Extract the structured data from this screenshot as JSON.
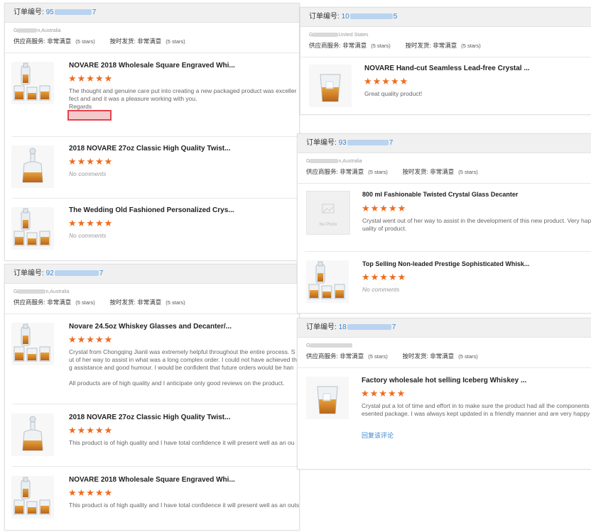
{
  "labels": {
    "order_prefix": "订单编号:",
    "supplier_service": "供应商服务:",
    "on_time_shipping": "按时发货:",
    "very_satisfied": "非常满意",
    "five_stars": "(5 stars)",
    "stars": "★★★★★",
    "no_comments": "No comments",
    "no_photo": "No Photo",
    "reply_link": "回复该评论"
  },
  "orders": [
    {
      "order_start": "95",
      "order_end": "7",
      "loc_start": "G",
      "loc_end": "n,Australia",
      "items": [
        {
          "title": "NOVARE 2018 Wholesale Square Engraved Whi...",
          "comment_lines": [
            "The thought and genuine care put into creating a new packaged product was exceller",
            "fect and and it was a pleasure working with you.",
            "Regards"
          ]
        },
        {
          "title": "2018 NOVARE 27oz Classic High Quality Twist...",
          "no_comments": true
        },
        {
          "title": "The Wedding Old Fashioned Personalized Crys...",
          "no_comments": true
        }
      ]
    },
    {
      "order_start": "10",
      "order_end": "5",
      "loc_start": "G",
      "loc_end": "United States",
      "items": [
        {
          "title": "NOVARE Hand-cut Seamless Lead-free Crystal ...",
          "comment_lines": [
            "Great quality product!"
          ]
        }
      ]
    },
    {
      "order_start": "93",
      "order_end": "7",
      "loc_start": "G",
      "loc_end": "n,Australia",
      "items": [
        {
          "title": "800 ml Fashionable Twisted Crystal Glass Decanter",
          "comment_lines": [
            "Crystal went out of her way to assist in the development of this new product. Very hap",
            "uality of product."
          ]
        },
        {
          "title": "Top Selling Non-leaded Prestige Sophisticated Whisk...",
          "no_comments": true
        }
      ]
    },
    {
      "order_start": "92",
      "order_end": "7",
      "loc_start": "G",
      "loc_end": "n,Australia",
      "items": [
        {
          "title": "Novare 24.5oz Whiskey Glasses and Decanter/...",
          "comment_lines": [
            "Crystal from Chongqing Jianli was extremely helpful throughout the entire process. S",
            "ut of her way to assist in what was a long complex order. I could not have achieved th",
            "g assistance and good humour. I would be confident that future orders would be han",
            "",
            "All products are of high quality and I anticipate only good reviews on the product."
          ]
        },
        {
          "title": "2018 NOVARE 27oz Classic High Quality Twist...",
          "comment_lines": [
            "This product is of high quality and I have total confidence it will present well as an ou"
          ]
        },
        {
          "title": "NOVARE 2018 Wholesale Square Engraved Whi...",
          "comment_lines": [
            "This product is of high quality and I have total confidence it will present well as an outstanding item"
          ]
        }
      ]
    },
    {
      "order_start": "18",
      "order_end": "7",
      "loc_start": "G",
      "loc_end": "",
      "items": [
        {
          "title": "Factory wholesale hot selling Iceberg Whiskey ...",
          "comment_lines": [
            "Crystal put a lot of time and effort in to make sure the product had all the components",
            "esented package. I was always kept updated in a friendly manner and are very happy"
          ]
        }
      ]
    }
  ],
  "colors": {
    "star": "#ee6b1e",
    "link": "#3b86d0",
    "redact": "#e3424b"
  }
}
